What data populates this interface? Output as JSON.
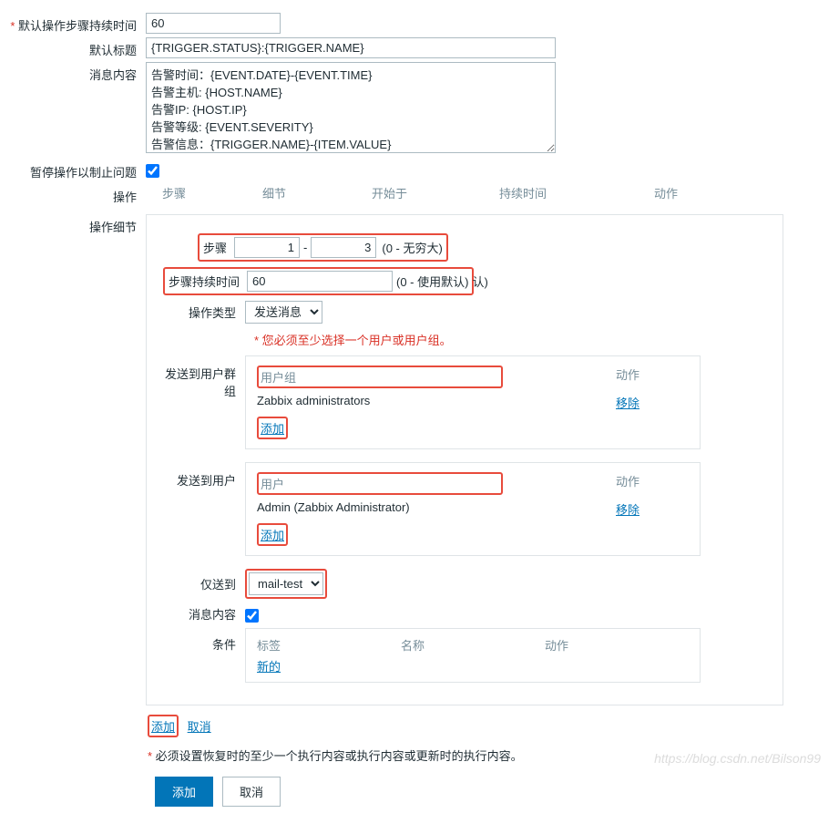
{
  "labels": {
    "default_step_duration": "默认操作步骤持续时间",
    "default_subject": "默认标题",
    "message": "消息内容",
    "pause_ops": "暂停操作以制止问题",
    "operations": "操作",
    "operation_details": "操作细节"
  },
  "values": {
    "default_step_duration": "60",
    "default_subject": "{TRIGGER.STATUS}:{TRIGGER.NAME}",
    "message": "告警时间：{EVENT.DATE}-{EVENT.TIME}\n告警主机: {HOST.NAME}\n告警IP: {HOST.IP}\n告警等级: {EVENT.SEVERITY}\n告警信息：{TRIGGER.NAME}-{ITEM.VALUE}\n事件ID: {EVENT.ID}"
  },
  "ops_header": {
    "step": "步骤",
    "detail": "细节",
    "start": "开始于",
    "duration": "持续时间",
    "action": "动作"
  },
  "details": {
    "step_label": "步骤",
    "step_from": "1",
    "step_to": "3",
    "step_hint": "(0 - 无穷大)",
    "duration_label": "步骤持续时间",
    "duration_value": "60",
    "duration_hint": "(0 - 使用默认)",
    "op_type_label": "操作类型",
    "op_type_value": "发送消息",
    "must_select": "您必须至少选择一个用户或用户组。",
    "send_group_label": "发送到用户群组",
    "send_user_label": "发送到用户",
    "group_header": "用户组",
    "user_header": "用户",
    "action_header": "动作",
    "group_row": "Zabbix administrators",
    "user_row": "Admin (Zabbix Administrator)",
    "remove": "移除",
    "add": "添加",
    "send_only_label": "仅送到",
    "send_only_value": "mail-test",
    "msg_label": "消息内容",
    "cond_label": "条件",
    "cond_tag": "标签",
    "cond_name": "名称",
    "cond_action": "动作",
    "cond_new": "新的"
  },
  "footer": {
    "add": "添加",
    "cancel": "取消",
    "recovery_note": "必须设置恢复时的至少一个执行内容或执行内容或更新时的执行内容。"
  },
  "buttons": {
    "add": "添加",
    "cancel": "取消"
  },
  "watermark": "https://blog.csdn.net/Bilson99"
}
